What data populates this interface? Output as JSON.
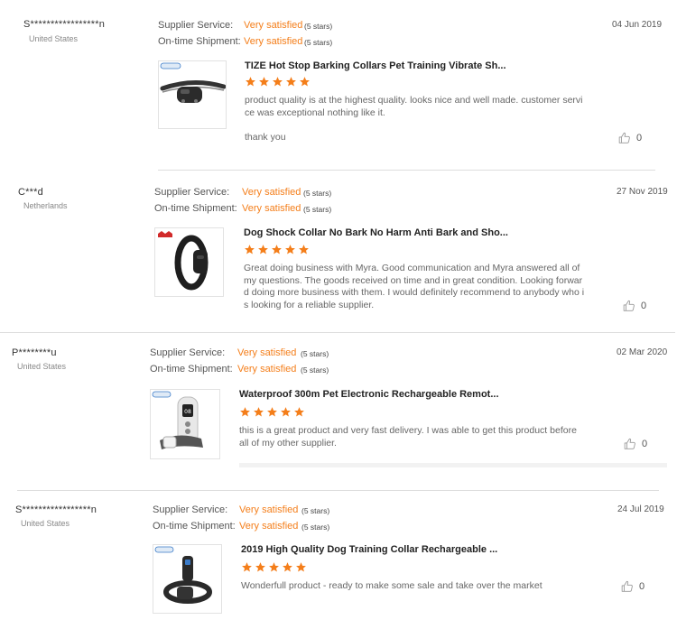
{
  "labels": {
    "supplier_service": "Supplier Service:",
    "on_time_shipment": "On-time Shipment:",
    "rating_text": "Very satisfied",
    "rating_stars": "(5 stars)"
  },
  "colors": {
    "accent": "#f47e1a",
    "star": "#f47e1a"
  },
  "reviews": [
    {
      "user": "S*****************n",
      "country": "United States",
      "date": "04 Jun 2019",
      "product_title": "TIZE Hot Stop Barking Collars Pet Training Vibrate Sh...",
      "product_rating": 5,
      "text_lines": [
        "product quality is at the highest quality. looks nice and well made. customer servi",
        "ce was exceptional nothing like it.",
        "",
        "thank you"
      ],
      "likes": "0",
      "image_icon": "bark-collar-image"
    },
    {
      "user": "C***d",
      "country": "Netherlands",
      "date": "27 Nov 2019",
      "product_title": "Dog Shock Collar No Bark No Harm Anti Bark and Sho...",
      "product_rating": 5,
      "text_lines": [
        "Great doing business with Myra. Good communication and Myra answered all of",
        "my questions. The goods received on time and in great condition. Looking forwar",
        "d doing more business with them. I would definitely recommend to anybody who i",
        "s looking for a reliable supplier."
      ],
      "likes": "0",
      "image_icon": "black-collar-image"
    },
    {
      "user": "P********u",
      "country": "United States",
      "date": "02 Mar 2020",
      "product_title": "Waterproof 300m Pet Electronic Rechargeable Remot...",
      "product_rating": 5,
      "text_lines": [
        "this is a great product and very fast delivery. I was able to get this product before",
        "all of my other supplier."
      ],
      "likes": "0",
      "image_icon": "remote-trainer-image"
    },
    {
      "user": "S*****************n",
      "country": "United States",
      "date": "24 Jul 2019",
      "product_title": "2019 High Quality Dog Training Collar Rechargeable ...",
      "product_rating": 5,
      "text_lines": [
        "Wonderfull product - ready to make some sale and take over the market"
      ],
      "likes": "0",
      "image_icon": "training-collar-image"
    }
  ]
}
